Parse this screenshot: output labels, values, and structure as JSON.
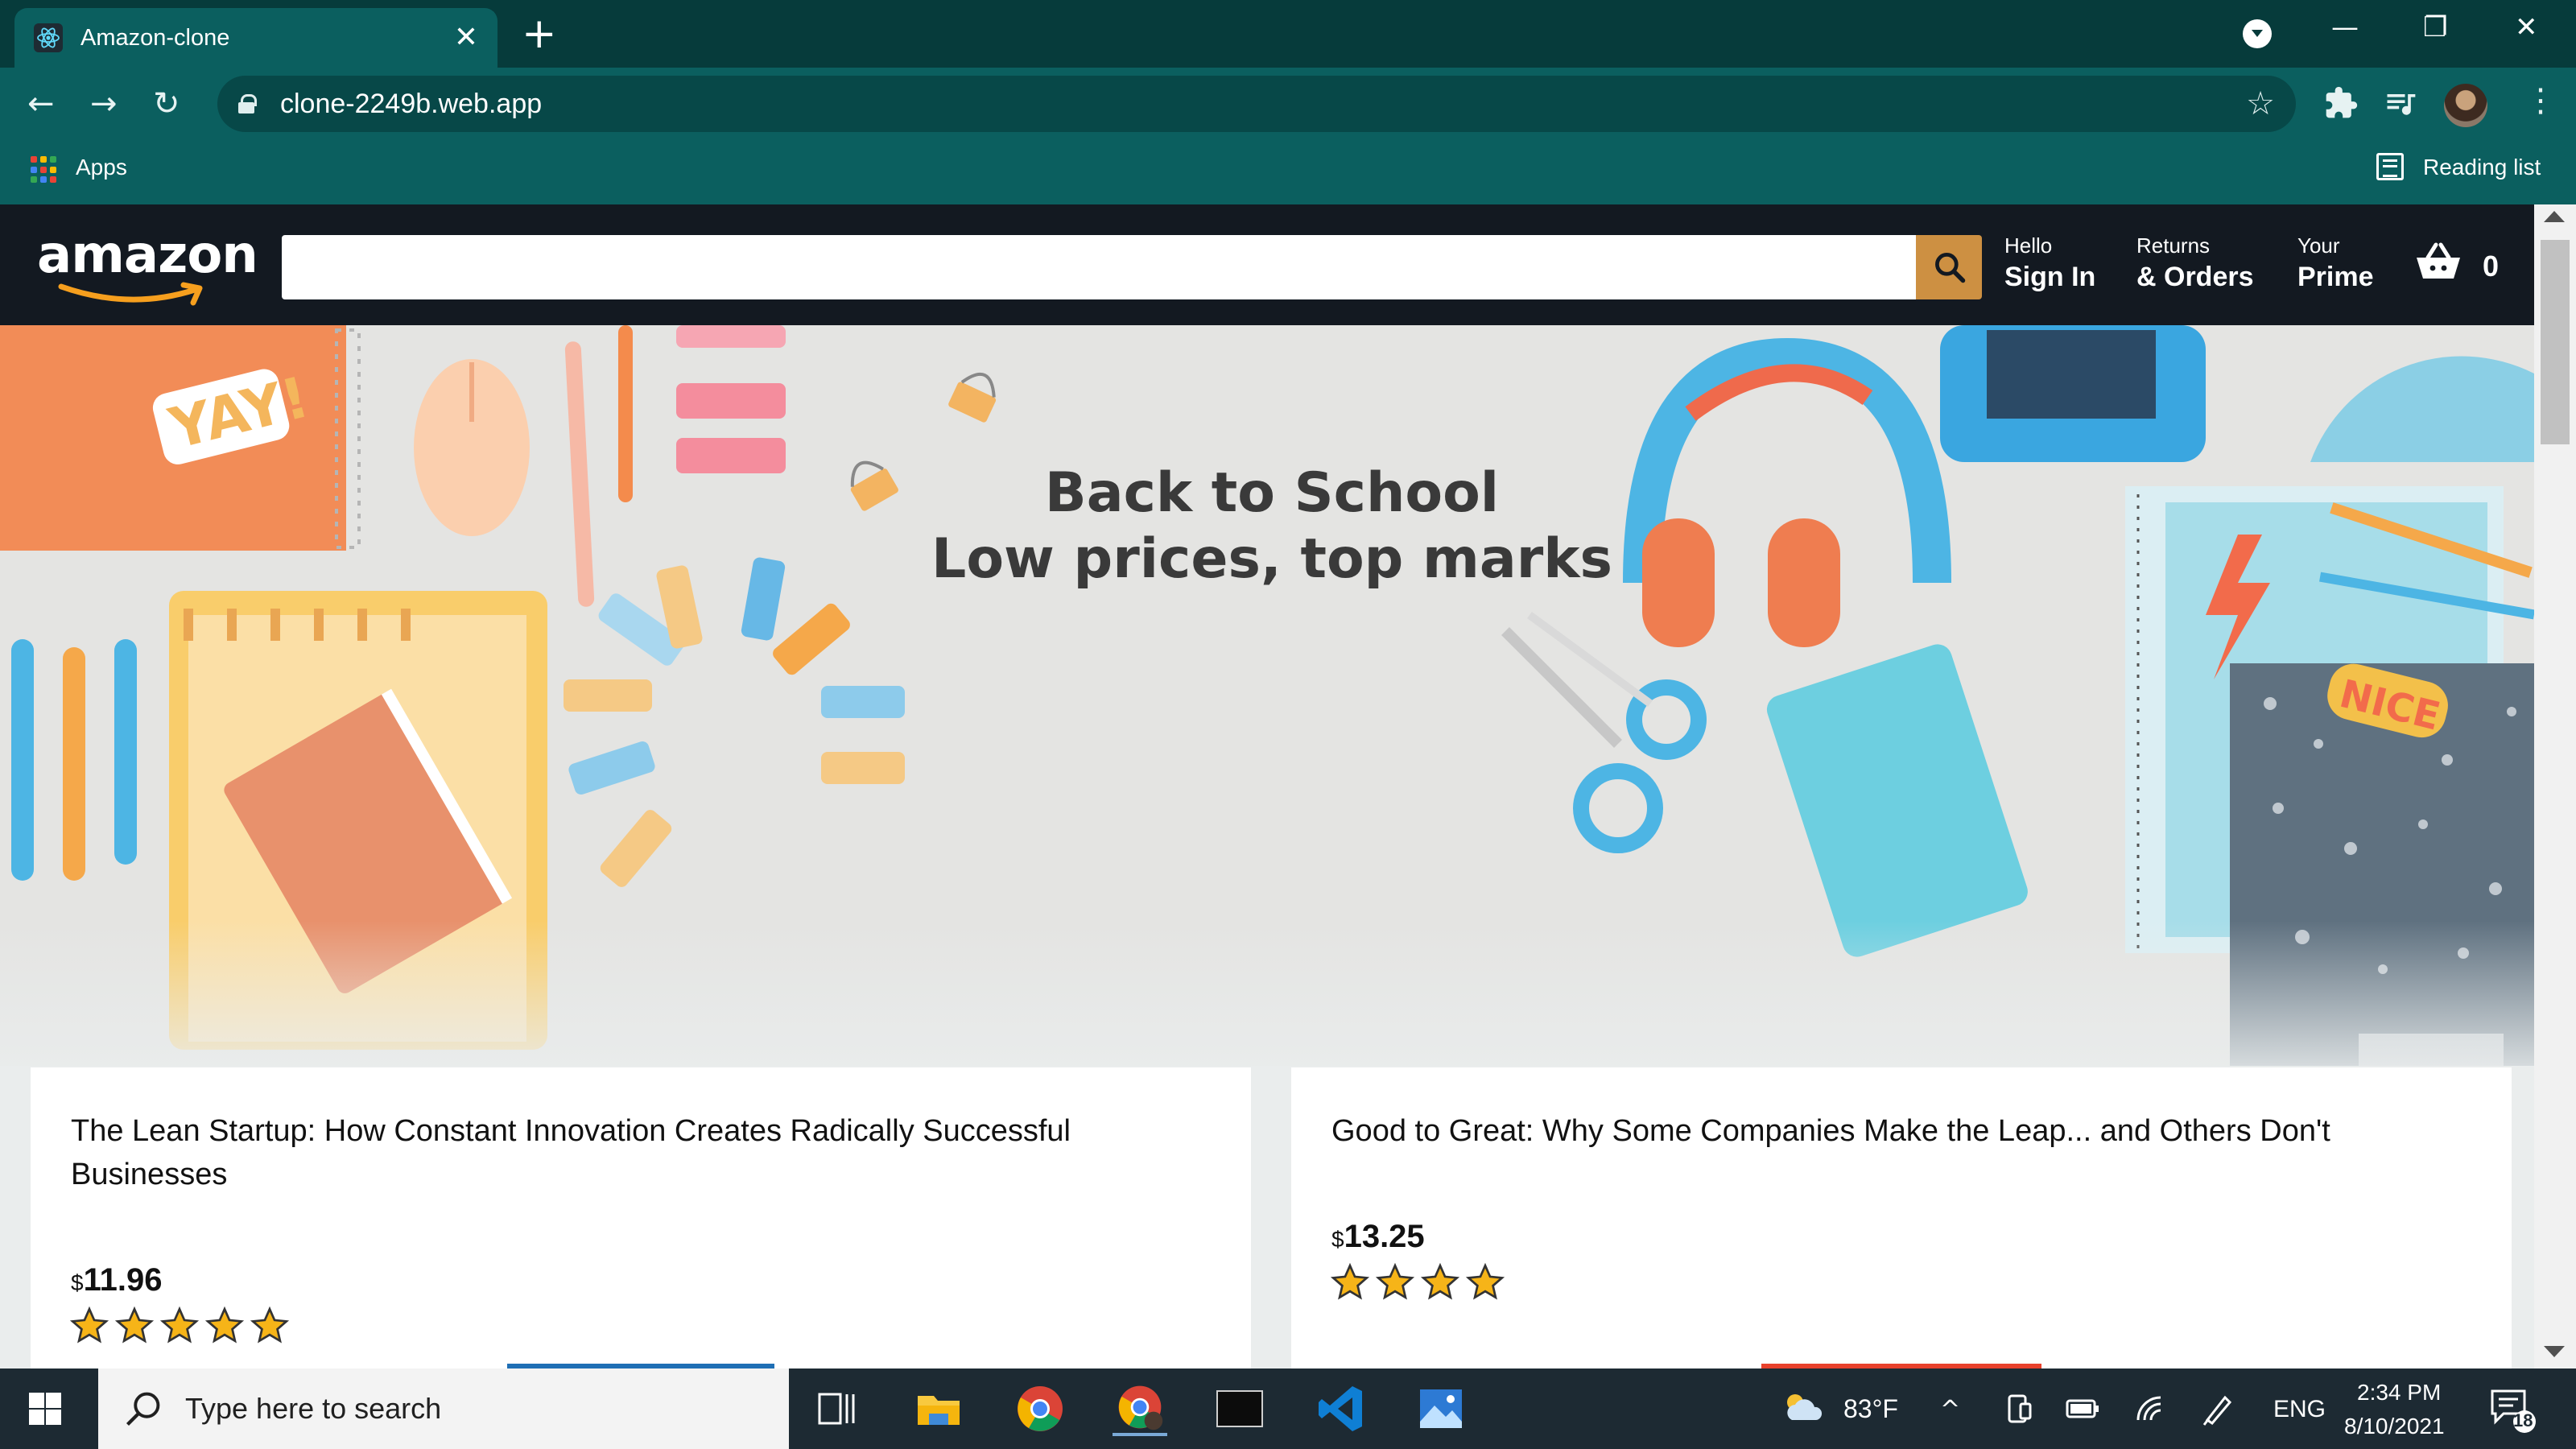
{
  "browser": {
    "tab_title": "Amazon-clone",
    "tab_close": "✕",
    "new_tab": "+",
    "url": "clone-2249b.web.app",
    "nav": {
      "back": "←",
      "forward": "→",
      "reload": "↻"
    },
    "bookmark_star": "☆",
    "bookmarks": {
      "apps_label": "Apps",
      "reading_list_label": "Reading list"
    },
    "window_controls": {
      "minimize": "—",
      "restore": "❐",
      "close": "✕"
    },
    "menu": "⋮",
    "extensions_icon": "puzzle-icon",
    "media_icon": "playlist-icon"
  },
  "header": {
    "logo_text": "amazon",
    "search_placeholder": "",
    "signin": {
      "line1": "Hello",
      "line2": "Sign In"
    },
    "orders": {
      "line1": "Returns",
      "line2": "& Orders"
    },
    "prime": {
      "line1": "Your",
      "line2": "Prime"
    },
    "basket_count": "0",
    "colors": {
      "header_bg": "#131921",
      "search_button": "#cd9042"
    }
  },
  "hero": {
    "line1": "Back to School",
    "line2": "Low prices, top marks"
  },
  "products": [
    {
      "title": "The Lean Startup: How Constant Innovation Creates Radically Successful Businesses",
      "currency": "$",
      "price": "11.96",
      "rating": 5,
      "button_color": "#1f6fb5"
    },
    {
      "title": "Good to Great: Why Some Companies Make the Leap... and Others Don't",
      "currency": "$",
      "price": "13.25",
      "rating": 4,
      "button_color": "#e8412c"
    }
  ],
  "taskbar": {
    "search_placeholder": "Type here to search",
    "weather": "83°F",
    "language": "ENG",
    "time": "2:34 PM",
    "date": "8/10/2021",
    "notification_count": "18"
  }
}
